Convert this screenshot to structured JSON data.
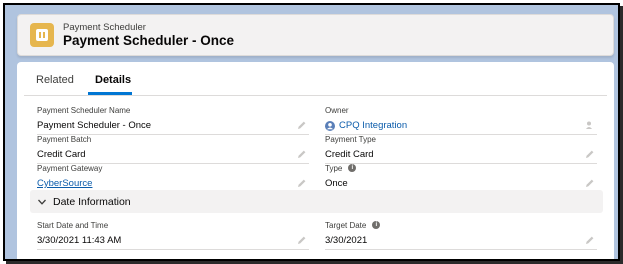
{
  "header": {
    "object_type": "Payment Scheduler",
    "record_title": "Payment Scheduler - Once"
  },
  "tabs": [
    {
      "label": "Related",
      "active": false
    },
    {
      "label": "Details",
      "active": true
    }
  ],
  "fields": {
    "name": {
      "label": "Payment Scheduler Name",
      "value": "Payment Scheduler - Once"
    },
    "owner": {
      "label": "Owner",
      "value": "CPQ Integration"
    },
    "batch": {
      "label": "Payment Batch",
      "value": "Credit Card"
    },
    "payment_type": {
      "label": "Payment Type",
      "value": "Credit Card"
    },
    "gateway": {
      "label": "Payment Gateway",
      "value": "CyberSource"
    },
    "type": {
      "label": "Type",
      "value": "Once"
    },
    "start": {
      "label": "Start Date and Time",
      "value": "3/30/2021 11:43 AM"
    },
    "target": {
      "label": "Target Date",
      "value": "3/30/2021"
    }
  },
  "section": {
    "title": "Date Information",
    "expanded": true
  },
  "colors": {
    "accent": "#0176d3",
    "link": "#0b5cab",
    "object_icon": "#e6b64e"
  },
  "icons": [
    "payment-scheduler-icon",
    "pencil-icon",
    "info-icon",
    "user-icon",
    "chevron-down-icon"
  ]
}
